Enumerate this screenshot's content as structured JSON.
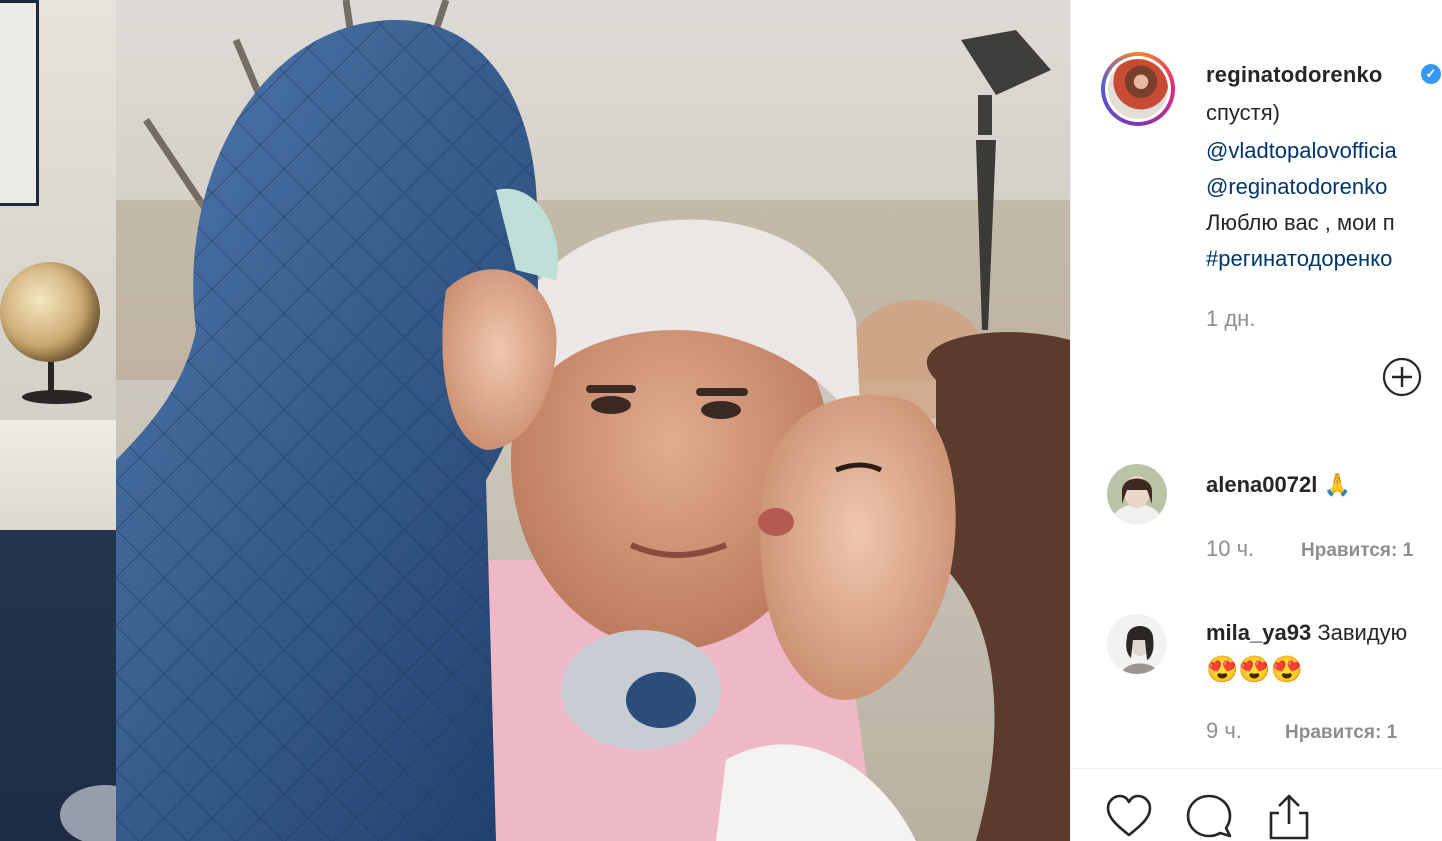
{
  "post": {
    "username": "reginatodorenko",
    "verified_badge": "✓",
    "caption_lines": [
      {
        "text": "спустя)",
        "kind": "text"
      },
      {
        "text": "@vladtopalovofficia",
        "kind": "link"
      },
      {
        "text": "@reginatodorenko",
        "kind": "link"
      },
      {
        "text": "Люблю вас , мои п",
        "kind": "text"
      },
      {
        "text": "#регинатодоренко",
        "kind": "link"
      }
    ],
    "time": "1 дн.",
    "add_icon": "plus-circle-icon"
  },
  "comments": [
    {
      "user": "alena0072l",
      "text": "🙏",
      "emojis": "",
      "time": "10 ч.",
      "likes": "Нравится: 1"
    },
    {
      "user": "mila_ya93",
      "text": "Завидую",
      "emojis": "😍😍😍",
      "time": "9 ч.",
      "likes": "Нравится: 1"
    }
  ],
  "actions": {
    "like_icon": "heart-icon",
    "comment_icon": "comment-icon",
    "share_icon": "share-icon"
  },
  "colors": {
    "text": "#262626",
    "link": "#003569",
    "muted": "#8e8e8e",
    "verified": "#3897f0"
  }
}
